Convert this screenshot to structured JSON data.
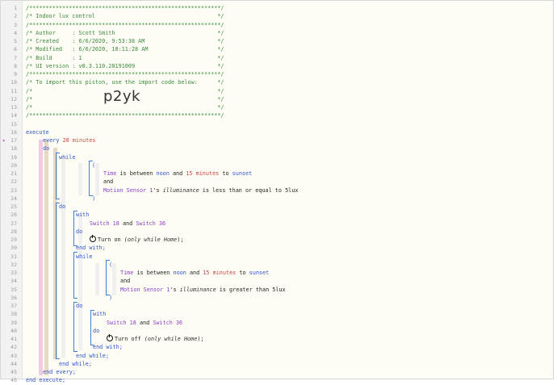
{
  "header_comments": [
    "/**********************************************************/",
    "/* Indoor lux control                                     */",
    "/**********************************************************/",
    "/* Author     : Scott Smith                               */",
    "/* Created    : 6/6/2020, 9:53:38 AM                      */",
    "/* Modified   : 6/6/2020, 10:11:28 AM                     */",
    "/* Build      : 1                                         */",
    "/* UI version : v0.3.110.20191009                         */",
    "/**********************************************************/",
    "/* To import this piston, use the import code below:      */",
    "/*                                                        */",
    "/*                                                        */",
    "/*                                                        */",
    "/**********************************************************/"
  ],
  "import_code": "p2yk",
  "line_numbers": [
    "1",
    "2",
    "3",
    "4",
    "5",
    "6",
    "7",
    "8",
    "9",
    "10",
    "11",
    "12",
    "13",
    "14",
    "15",
    "16",
    "17",
    "18",
    "19",
    "20",
    "21",
    "22",
    "23",
    "24",
    "25",
    "26",
    "27",
    "28",
    "29",
    "30",
    "31",
    "32",
    "33",
    "34",
    "35",
    "36",
    "37",
    "38",
    "39",
    "40",
    "41",
    "42",
    "43",
    "44",
    "45",
    "46"
  ],
  "code": {
    "execute": "execute",
    "every": "every",
    "every_value": "20",
    "every_unit": "minutes",
    "do": "do",
    "while": "while",
    "open_paren": "(",
    "close_paren": ")",
    "time": "Time",
    "is_between": "is between",
    "noon": "noon",
    "and": "and",
    "fifteen": "15",
    "minutes": "minutes",
    "to": "to",
    "sunset": "sunset",
    "motion_sensor": "Motion Sensor 1",
    "apostrophe_s": "'s",
    "illuminance": "illuminance",
    "less_than_eq": "is less than or equal to",
    "greater_than": "is greater than",
    "lux": "5lux",
    "with": "with",
    "switch_18": "Switch 18",
    "switch_36": "Switch 36",
    "turn_on": "Turn on",
    "turn_off": "Turn off",
    "only_while": "(only while",
    "home": "Home",
    "close_semicolon": ");",
    "end_with": "end with;",
    "end_while": "end while;",
    "end_every": "end every;",
    "end_execute": "end execute;"
  },
  "colors": {
    "comment": "#3b8a3b",
    "keyword": "#2f55c8",
    "number": "#c44444",
    "device": "#8a3fc9",
    "bracket": "#3d7fd1"
  }
}
